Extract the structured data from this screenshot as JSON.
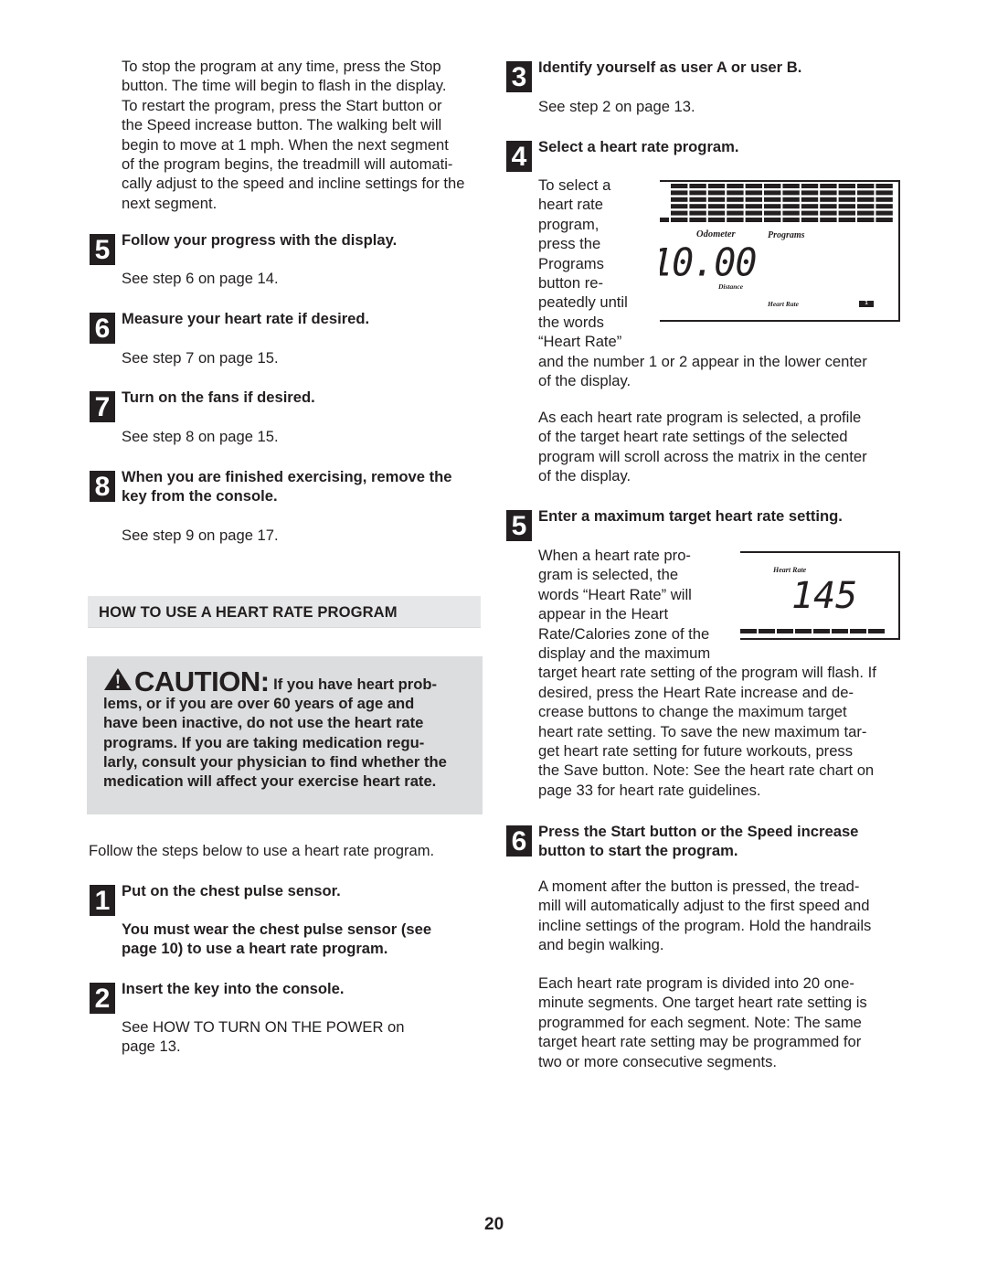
{
  "left_column": {
    "intro_paragraph": [
      "To stop the program at any time, press the Stop",
      "button. The time will begin to flash in the display.",
      "To restart the program, press the Start button or",
      "the Speed increase button. The walking belt will",
      "begin to move at 1 mph. When the next segment",
      "of the program begins, the treadmill will automati-",
      "cally adjust to the speed and incline settings for the",
      "next segment."
    ],
    "steps": [
      {
        "number": "5",
        "title": [
          "Follow your progress with the display."
        ],
        "body": [
          "See step 6 on page 14."
        ]
      },
      {
        "number": "6",
        "title": [
          "Measure your heart rate if desired."
        ],
        "body": [
          "See step 7 on page 15."
        ]
      },
      {
        "number": "7",
        "title": [
          "Turn on the fans if desired."
        ],
        "body": [
          "See step 8 on page 15."
        ]
      },
      {
        "number": "8",
        "title": [
          "When you are finished exercising, remove the",
          "key from the console."
        ],
        "body": [
          "See step 9 on page 17."
        ]
      }
    ],
    "section_header": "HOW TO USE A HEART RATE PROGRAM",
    "caution": {
      "icon": "warning-triangle-icon",
      "label": "CAUTION:",
      "lines": [
        "If you have heart prob-",
        "lems, or if you are over 60 years of age and",
        "have been inactive, do not use the heart rate",
        "programs. If you are taking medication regu-",
        "larly, consult your physician to find whether the",
        "medication will affect your exercise heart rate."
      ]
    },
    "follow_text": "Follow the steps below to use a heart rate program.",
    "hr_steps": [
      {
        "number": "1",
        "title": [
          "Put on the chest pulse sensor."
        ],
        "body_bold": [
          "You must wear the chest pulse sensor (see",
          "page 10) to use a heart rate program."
        ]
      },
      {
        "number": "2",
        "title": [
          "Insert the key into the console."
        ],
        "body": [
          "See HOW TO TURN ON THE POWER on",
          "page 13."
        ]
      }
    ]
  },
  "right_column": {
    "step3": {
      "number": "3",
      "title": "Identify yourself as user A or user B.",
      "body": "See step 2 on page 13."
    },
    "step4": {
      "number": "4",
      "title": "Select a heart rate program.",
      "side_text": [
        "To select a",
        "heart rate",
        "program,",
        "press the",
        "Programs",
        "button re-",
        "peatedly until",
        "the words",
        "“Heart Rate”"
      ],
      "after_text": [
        "and the number 1 or 2 appear in the lower center",
        "of the display."
      ],
      "para2": [
        "As each heart rate program is selected, a profile",
        "of the target heart rate settings of the selected",
        "program will scroll across the matrix in the center",
        "of the display."
      ],
      "display": {
        "odometer_label": "Odometer",
        "programs_label": "Programs",
        "distance_value": "10.00",
        "distance_label": "Distance",
        "heart_rate_label": "Heart Rate",
        "program_number": "1"
      }
    },
    "step5": {
      "number": "5",
      "title": "Enter a maximum target heart rate setting.",
      "side_text": [
        "When a heart rate pro-",
        "gram is selected, the",
        "words “Heart Rate” will",
        "appear in the Heart",
        "Rate/Calories zone of the",
        "display and the maximum"
      ],
      "after_text": [
        "target heart rate setting of the program will flash. If",
        "desired, press the Heart Rate increase and de-",
        "crease buttons to change the maximum target",
        "heart rate setting. To save the new maximum tar-",
        "get heart rate setting for future workouts, press",
        "the Save button. Note: See the heart rate chart on",
        "page 33 for heart rate guidelines."
      ],
      "display": {
        "heart_rate_label": "Heart Rate",
        "value": "145"
      }
    },
    "step6": {
      "number": "6",
      "title": [
        "Press the Start button or the Speed increase",
        "button to start the program."
      ],
      "para1": [
        "A moment after the button is pressed, the tread-",
        "mill will automatically adjust to the first speed and",
        "incline settings of the program. Hold the handrails",
        "and begin walking."
      ],
      "para2": [
        "Each heart rate program is divided into 20 one-",
        "minute segments. One target heart rate setting is",
        "programmed for each segment. Note: The same",
        "target heart rate setting may be programmed for",
        "two or more consecutive segments."
      ]
    }
  },
  "page_number": "20"
}
